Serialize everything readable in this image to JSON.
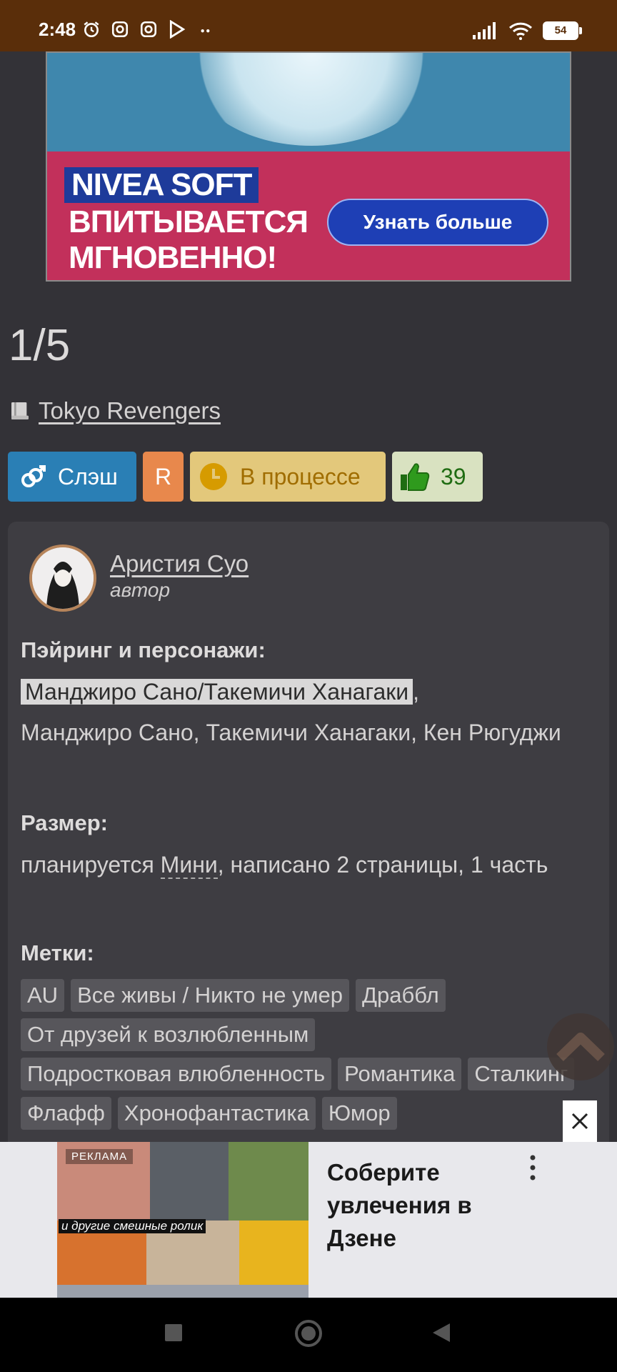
{
  "status_bar": {
    "time": "2:48",
    "battery": "54"
  },
  "ad_banner": {
    "line1": "NIVEA SOFT",
    "line2": "ВПИТЫВАЕТСЯ",
    "line3": "МГНОВЕННО!",
    "button": "Узнать больше"
  },
  "chapter_counter": "1/5",
  "fandom": "Tokyo Revengers",
  "badges": {
    "direction": "Слэш",
    "rating": "R",
    "status": "В процессе",
    "likes": "39"
  },
  "author": {
    "name": "Аристия Суо",
    "role": "автор"
  },
  "pairing": {
    "label": "Пэйринг и персонажи:",
    "main_pair": "Манджиро Сано/Такемичи Ханагаки",
    "characters": "Манджиро Сано, Такемичи Ханагаки, Кен Рюгуджи"
  },
  "size": {
    "label": "Размер:",
    "prefix": "планируется",
    "size_name": "Мини",
    "suffix": ", написано 2 страницы, 1 часть"
  },
  "tags": {
    "label": "Метки:",
    "items": [
      "AU",
      "Все живы / Никто не умер",
      "Драббл",
      "От друзей к возлюбленным",
      "Подростковая влюбленность",
      "Романтика",
      "Сталкинг",
      "Флафф",
      "Хронофантастика",
      "Юмор"
    ]
  },
  "bottom_ad": {
    "label": "РЕКЛАМА",
    "caption": "и другие смешные ролик",
    "text": "Соберите увлечения в Дзене"
  },
  "colors": {
    "background": "#333237",
    "card": "#3e3d42",
    "slash_badge": "#2a7fb5",
    "rating_badge": "#e8884c",
    "status_badge": "#e3c87b",
    "likes_badge": "#d9e2c1"
  }
}
